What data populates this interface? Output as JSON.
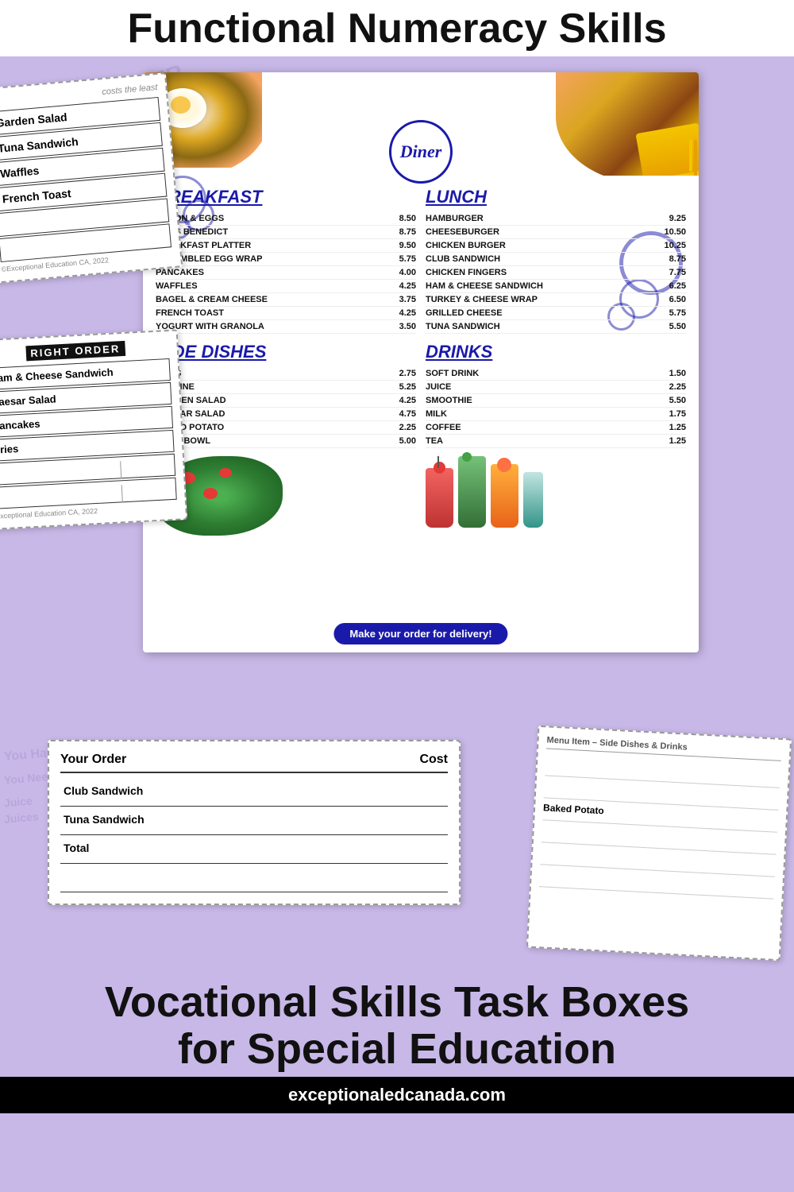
{
  "header": {
    "title": "Functional Numeracy Skills"
  },
  "diner": {
    "name": "Diner",
    "breakfast": {
      "title": "BREAKFAST",
      "items": [
        {
          "name": "BACON & EGGS",
          "price": "8.50"
        },
        {
          "name": "EGGS BENEDICT",
          "price": "8.75"
        },
        {
          "name": "BREAKFAST PLATTER",
          "price": "9.50"
        },
        {
          "name": "SCRAMBLED EGG WRAP",
          "price": "5.75"
        },
        {
          "name": "PANCAKES",
          "price": "4.00"
        },
        {
          "name": "WAFFLES",
          "price": "4.25"
        },
        {
          "name": "BAGEL & CREAM CHEESE",
          "price": "3.75"
        },
        {
          "name": "FRENCH TOAST",
          "price": "4.25"
        },
        {
          "name": "YOGURT WITH GRANOLA",
          "price": "3.50"
        }
      ]
    },
    "lunch": {
      "title": "LUNCH",
      "items": [
        {
          "name": "HAMBURGER",
          "price": "9.25"
        },
        {
          "name": "CHEESEBURGER",
          "price": "10.50"
        },
        {
          "name": "CHICKEN BURGER",
          "price": "10.25"
        },
        {
          "name": "CLUB SANDWICH",
          "price": "8.75"
        },
        {
          "name": "CHICKEN FINGERS",
          "price": "7.75"
        },
        {
          "name": "HAM & CHEESE SANDWICH",
          "price": "6.25"
        },
        {
          "name": "TURKEY & CHEESE WRAP",
          "price": "6.50"
        },
        {
          "name": "GRILLED CHEESE",
          "price": "5.75"
        },
        {
          "name": "TUNA SANDWICH",
          "price": "5.50"
        }
      ]
    },
    "side_dishes": {
      "title": "SIDE DISHES",
      "items": [
        {
          "name": "FRIES",
          "price": "2.75"
        },
        {
          "name": "POUTINE",
          "price": "5.25"
        },
        {
          "name": "GARDEN SALAD",
          "price": "4.25"
        },
        {
          "name": "CAESAR SALAD",
          "price": "4.75"
        },
        {
          "name": "BAKED POTATO",
          "price": "2.25"
        },
        {
          "name": "FRUIT BOWL",
          "price": "5.00"
        }
      ]
    },
    "drinks": {
      "title": "DRINKS",
      "items": [
        {
          "name": "SOFT DRINK",
          "price": "1.50"
        },
        {
          "name": "JUICE",
          "price": "2.25"
        },
        {
          "name": "SMOOTHIE",
          "price": "5.50"
        },
        {
          "name": "MILK",
          "price": "1.75"
        },
        {
          "name": "COFFEE",
          "price": "1.25"
        },
        {
          "name": "TEA",
          "price": "1.25"
        }
      ]
    },
    "delivery_text": "Make your order for delivery!"
  },
  "left_card": {
    "subtitle": "costs the least",
    "items": [
      "Garden Salad",
      "Tuna Sandwich",
      "Waffles",
      "French Toast"
    ]
  },
  "order_card_left": {
    "title": "RIGHT ORDER",
    "items": [
      "Ham & Cheese Sandwich",
      "Caesar Salad",
      "Pancakes",
      "Fries"
    ]
  },
  "your_order": {
    "header": "Your Order",
    "cost_label": "Cost",
    "items": [
      "Club Sandwich",
      "Tuna Sandwich",
      "Total"
    ]
  },
  "side_card": {
    "header": "Menu Item – Side Dishes & Drinks",
    "items": [
      "Baked Potato"
    ]
  },
  "footer": {
    "line1": "Vocational Skills Task Boxes",
    "line2": "for Special Education",
    "website": "exceptionaledcanada.com",
    "copyright": "©Exceptional Education CA, 2022"
  },
  "bg_watermarks": [
    "You Have",
    "You Need",
    "Juice",
    "Juices"
  ]
}
